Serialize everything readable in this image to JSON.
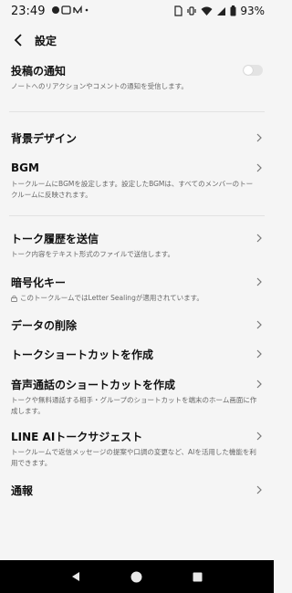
{
  "status_bar": {
    "time": "23:49",
    "battery": "93%"
  },
  "header": {
    "title": "設定"
  },
  "items": [
    {
      "title": "投稿の通知",
      "desc": "ノートへのリアクションやコメントの通知を受信します。",
      "toggle": false
    },
    {
      "title": "背景デザイン"
    },
    {
      "title": "BGM",
      "desc": "トークルームにBGMを設定します。設定したBGMは、すべてのメンバーのトークルームに反映されます。"
    },
    {
      "title": "トーク履歴を送信",
      "desc": "トーク内容をテキスト形式のファイルで送信します。"
    },
    {
      "title": "暗号化キー",
      "desc": "このトークルームではLetter Sealingが適用されています。"
    },
    {
      "title": "データの削除"
    },
    {
      "title": "トークショートカットを作成"
    },
    {
      "title": "音声通話のショートカットを作成",
      "desc": "トークや無料通話する相手・グループのショートカットを端末のホーム画面に作成します。"
    },
    {
      "title": "LINE AIトークサジェスト",
      "desc": "トークルームで返信メッセージの提案や口調の変更など、AIを活用した機能を利用できます。"
    },
    {
      "title": "通報"
    }
  ],
  "colors": {
    "background": "#f5f5f5",
    "text": "#111111",
    "subtext": "#666666",
    "divider": "#e2e2e2",
    "navbar": "#000000"
  }
}
